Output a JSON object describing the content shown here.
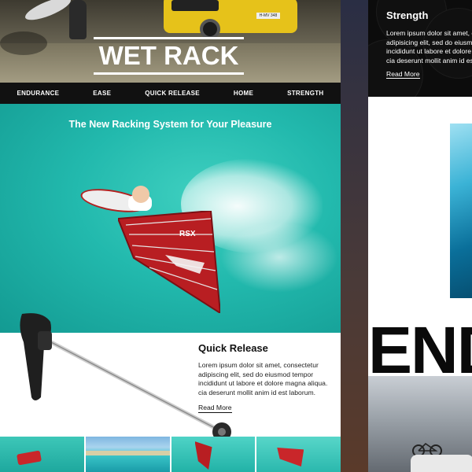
{
  "left_page": {
    "logo": "WET RACK",
    "van_plate": "H-MV 348",
    "nav": [
      "ENDURANCE",
      "EASE",
      "QUICK RELEASE",
      "HOME",
      "STRENGTH"
    ],
    "tagline": "The New Racking System for Your Pleasure",
    "sail_text": "RSX",
    "quick_release": {
      "title": "Quick Release",
      "body_lines": [
        "Lorem ipsum dolor sit amet, consectetur",
        "adipiscing elit, sed do eiusmod tempor",
        "incididunt ut labore et dolore magna aliqua.",
        "cia deserunt mollit anim id est laborum."
      ],
      "read_more": "Read More"
    }
  },
  "right_page": {
    "strength": {
      "title": "Strength",
      "body_lines": [
        "Lorem ipsum dolor sit amet, c",
        "adipisicing elit, sed do eiusm",
        "incididunt ut labore et dolore",
        "cia deserunt mollit anim id es"
      ],
      "read_more": "Read More"
    },
    "endurance_heading": "END"
  },
  "colors": {
    "ocean": "#22b9ad",
    "nav_bg": "#111111",
    "sail_red": "#b81e22",
    "van_yellow": "#e6c21a"
  }
}
